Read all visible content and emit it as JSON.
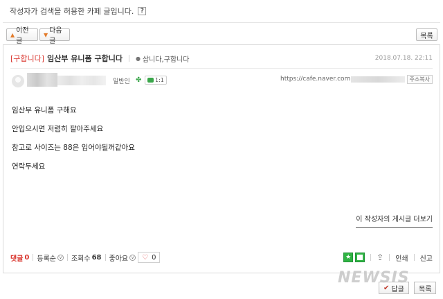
{
  "notice": {
    "text": "작성자가 검색을 허용한 카페 글입니다.",
    "help_icon": "?"
  },
  "nav": {
    "prev": "이전글",
    "next": "다음글",
    "list": "목록"
  },
  "post": {
    "category": "[구합니다]",
    "title": "임산부 유니폼 구합니다",
    "board": "삽니다,구합니다",
    "date": "2018.07.18. 22:11",
    "author_rank": "일반인",
    "chat_label": "1:1",
    "url_prefix": "https://cafe.naver.com",
    "copy_url_label": "주소복사",
    "body": [
      "임산부 유니폼 구해요",
      "안입으시면 저렴히 팔아주세요",
      "참고로 사이즈는 88은 입어야될꺼같아요",
      "연락두세요"
    ],
    "more_from_author": "이 작성자의 게시글 더보기"
  },
  "footer": {
    "comments_label": "댓글",
    "comments_count": "0",
    "sort_label": "등록순",
    "views_label": "조회수",
    "views_count": "68",
    "like_label": "좋아요",
    "like_count": "0",
    "print_label": "인쇄",
    "report_label": "신고"
  },
  "bottom": {
    "reply": "답글",
    "list": "목록"
  },
  "watermark": "NEWSIS",
  "colors": {
    "accent_red": "#d9332b",
    "green": "#2fb443",
    "arrow_orange": "#e37b2b"
  }
}
